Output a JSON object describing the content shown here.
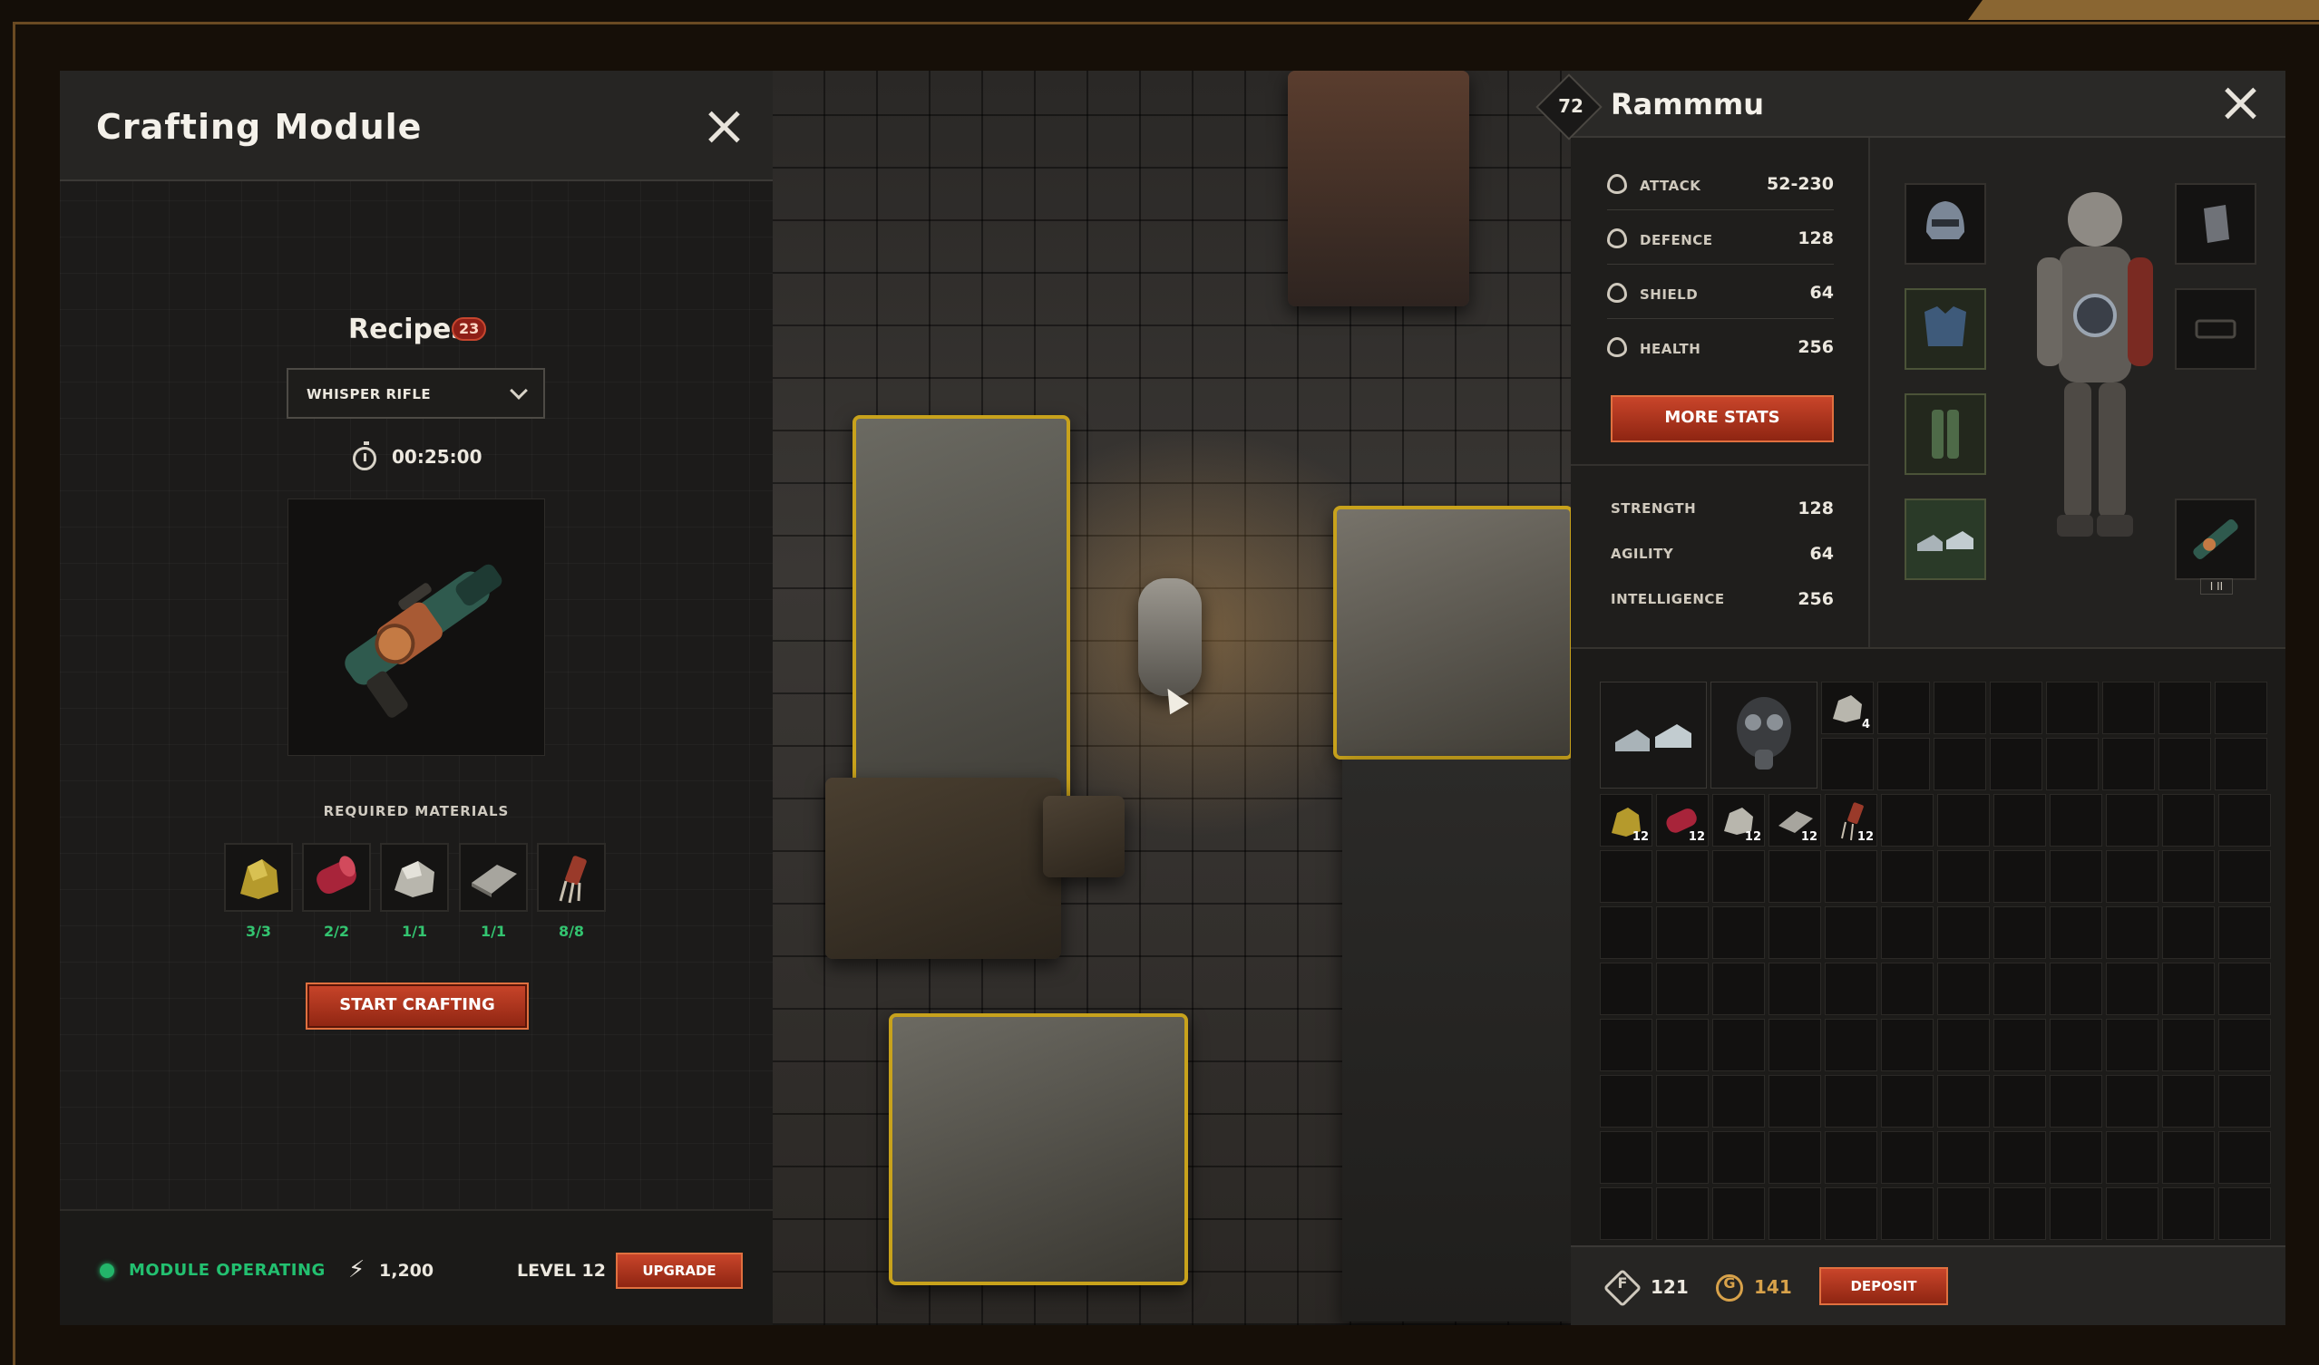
{
  "crafting": {
    "title": "Crafting Module",
    "recipes_label": "Recipes",
    "recipes_count": "23",
    "selected_recipe": "WHISPER RIFLE",
    "timer": "00:25:00",
    "required_label": "REQUIRED MATERIALS",
    "materials": [
      {
        "icon": "gold-ore-icon",
        "count": "3/3"
      },
      {
        "icon": "red-cloth-roll-icon",
        "count": "2/2"
      },
      {
        "icon": "silver-ore-icon",
        "count": "1/1"
      },
      {
        "icon": "metal-plate-icon",
        "count": "1/1"
      },
      {
        "icon": "wire-components-icon",
        "count": "8/8"
      }
    ],
    "start_label": "START CRAFTING",
    "status": "MODULE OPERATING",
    "power": "1,200",
    "level": "LEVEL 12",
    "upgrade_label": "UPGRADE"
  },
  "character": {
    "level": "72",
    "name": "Rammmu",
    "stats": [
      {
        "icon": "attack-icon",
        "label": "ATTACK",
        "value": "52-230"
      },
      {
        "icon": "defence-icon",
        "label": "DEFENCE",
        "value": "128"
      },
      {
        "icon": "shield-icon",
        "label": "SHIELD",
        "value": "64"
      },
      {
        "icon": "health-icon",
        "label": "HEALTH",
        "value": "256"
      }
    ],
    "more_stats_label": "MORE STATS",
    "attributes": [
      {
        "label": "STRENGTH",
        "value": "128"
      },
      {
        "label": "AGILITY",
        "value": "64"
      },
      {
        "label": "INTELLIGENCE",
        "value": "256"
      }
    ],
    "inventory_counts": {
      "stone": "4",
      "gold_ore": "12",
      "red_cloth": "12",
      "silver_ore": "12",
      "metal_plate": "12",
      "wire": "12"
    },
    "currency_f_symbol": "F",
    "currency_f": "121",
    "currency_g_symbol": "G",
    "currency_g": "141",
    "deposit_label": "DEPOSIT"
  },
  "colors": {
    "accent_red": "#c9452a",
    "status_green": "#23c070",
    "gold_currency": "#d8a24a"
  }
}
